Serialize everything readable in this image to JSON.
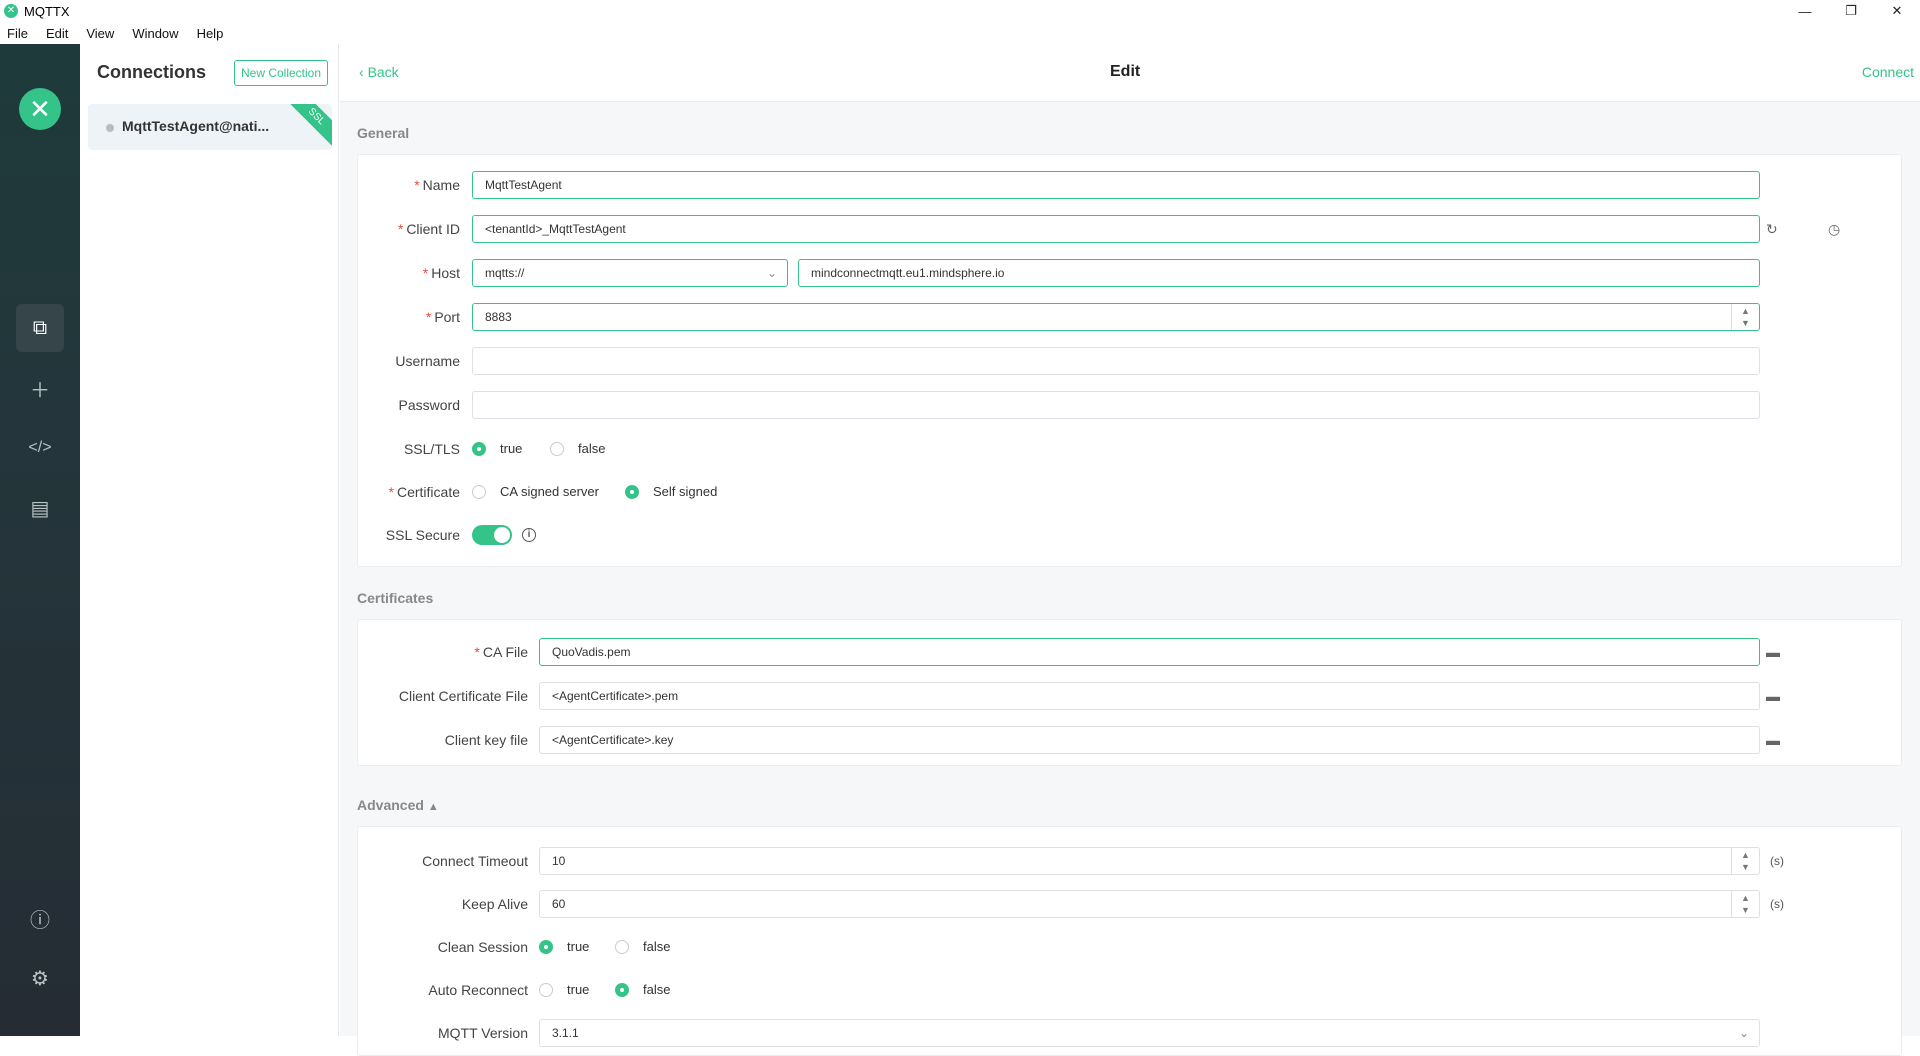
{
  "window": {
    "title": "MQTTX",
    "controls": {
      "minimize": "—",
      "restore": "❐",
      "close": "✕"
    }
  },
  "menu": [
    "File",
    "Edit",
    "View",
    "Window",
    "Help"
  ],
  "connections": {
    "heading": "Connections",
    "new_collection": "New Collection",
    "items": [
      {
        "label": "MqttTestAgent@nati...",
        "tag": "SSL"
      }
    ]
  },
  "topbar": {
    "back": "Back",
    "title": "Edit",
    "connect": "Connect"
  },
  "general": {
    "title": "General",
    "name_label": "Name",
    "name_value": "MqttTestAgent",
    "client_id_label": "Client ID",
    "client_id_value": "<tenantId>_MqttTestAgent",
    "host_label": "Host",
    "protocol_value": "mqtts://",
    "host_value": "mindconnectmqtt.eu1.mindsphere.io",
    "port_label": "Port",
    "port_value": "8883",
    "username_label": "Username",
    "username_value": "",
    "password_label": "Password",
    "password_value": "",
    "ssl_label": "SSL/TLS",
    "ssl_true": "true",
    "ssl_false": "false",
    "cert_label": "Certificate",
    "cert_ca": "CA signed server",
    "cert_self": "Self signed",
    "ssl_secure_label": "SSL Secure"
  },
  "certificates": {
    "title": "Certificates",
    "ca_label": "CA File",
    "ca_value": "QuoVadis.pem",
    "client_cert_label": "Client Certificate File",
    "client_cert_value": "<AgentCertificate>.pem",
    "client_key_label": "Client key file",
    "client_key_value": "<AgentCertificate>.key"
  },
  "advanced": {
    "title": "Advanced",
    "timeout_label": "Connect Timeout",
    "timeout_value": "10",
    "timeout_unit": "(s)",
    "keepalive_label": "Keep Alive",
    "keepalive_value": "60",
    "keepalive_unit": "(s)",
    "clean_label": "Clean Session",
    "clean_true": "true",
    "clean_false": "false",
    "reconnect_label": "Auto Reconnect",
    "reconnect_true": "true",
    "reconnect_false": "false",
    "mqtt_version_label": "MQTT Version",
    "mqtt_version_value": "3.1.1"
  },
  "colors": {
    "accent": "#34c388",
    "nav": "#24363b"
  }
}
